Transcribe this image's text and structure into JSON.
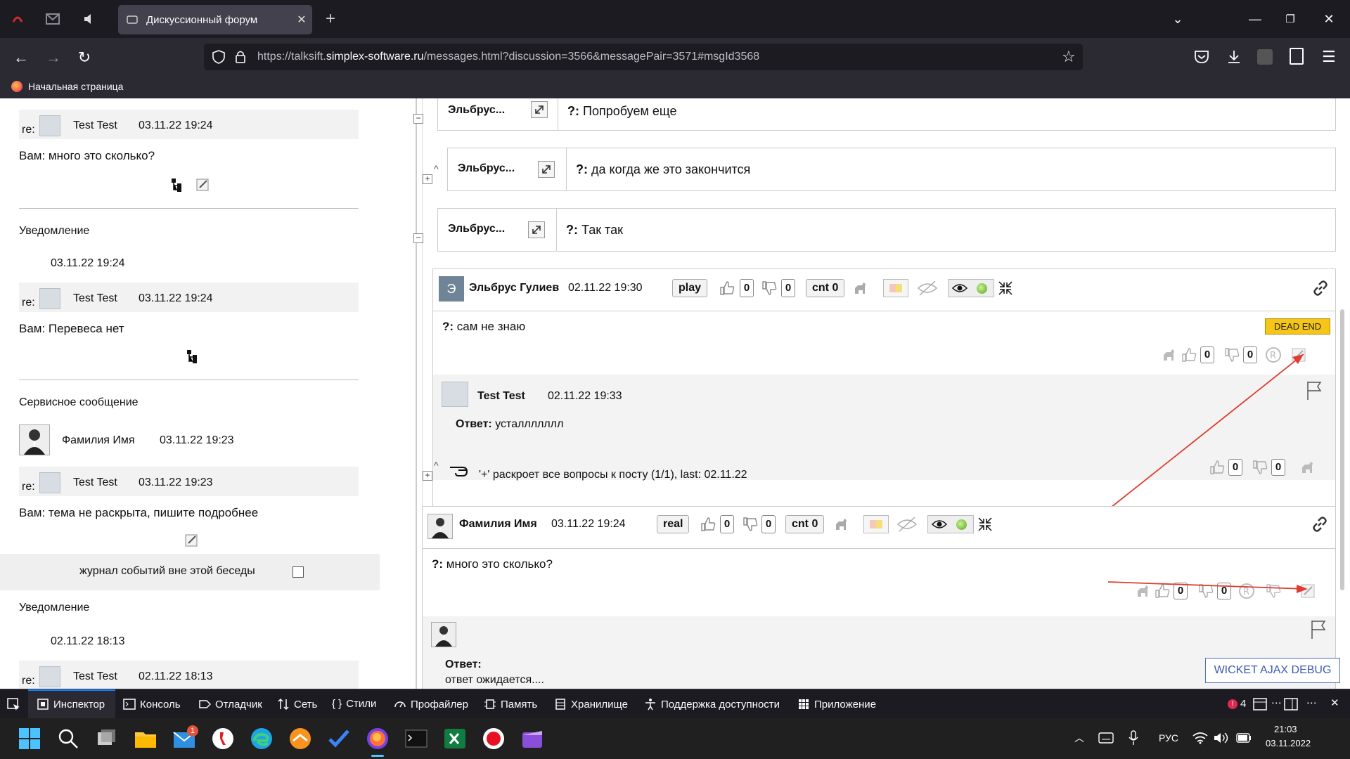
{
  "browser": {
    "tab_title": "Дискуссионный форум",
    "url_prefix": "https://talksift.",
    "url_domain": "simplex-software.ru",
    "url_rest": "/messages.html?discussion=3566&messagePair=3571#msgId3568",
    "bookmark": "Начальная страница"
  },
  "left": {
    "items": [
      {
        "re": "re:",
        "name": "Test Test",
        "date": "03.11.22 19:24",
        "text": "Вам: много это сколько?"
      },
      {
        "heading": "Уведомление",
        "date": "03.11.22 19:24"
      },
      {
        "re": "re:",
        "name": "Test Test",
        "date": "03.11.22 19:24",
        "text": "Вам: Перевеса нет"
      },
      {
        "heading": "Сервисное сообщение",
        "author": "Фамилия Имя",
        "date": "03.11.22 19:23"
      },
      {
        "re": "re:",
        "name": "Test Test",
        "date": "03.11.22 19:23",
        "text": "Вам: тема не раскрыта, пишите подробнее"
      },
      {
        "heading": "Уведомление",
        "date": "02.11.22 18:13"
      },
      {
        "re": "re:",
        "name": "Test Test",
        "date": "02.11.22 18:13"
      }
    ],
    "journal_label": "журнал событий вне этой беседы"
  },
  "right": {
    "collapsed": [
      {
        "name": "Эльбрус...",
        "prefix": "?:",
        "text": "Попробуем еще"
      },
      {
        "name": "Эльбрус...",
        "prefix": "?:",
        "text": "да когда же это закончится"
      },
      {
        "name": "Эльбрус...",
        "prefix": "?:",
        "text": "Так так"
      }
    ],
    "post1": {
      "avatar_letter": "Э",
      "author": "Эльбрус Гулиев",
      "date": "02.11.22 19:30",
      "mode": "play",
      "likes": "0",
      "dislikes": "0",
      "cnt": "cnt 0",
      "prefix": "?:",
      "question": "сам не знаю",
      "badge": "DEAD END",
      "q_likes": "0",
      "q_dislikes": "0",
      "answer_author": "Test Test",
      "answer_date": "02.11.22 19:33",
      "answer_label": "Ответ:",
      "answer_text": "усталлллллл",
      "a_likes": "0",
      "a_dislikes": "0",
      "hint": "'+' раскроет все вопросы к посту (1/1), last: 02.11.22"
    },
    "post2": {
      "author": "Фамилия Имя",
      "date": "03.11.22 19:24",
      "mode": "real",
      "likes": "0",
      "dislikes": "0",
      "cnt": "cnt 0",
      "prefix": "?:",
      "question": "много это сколько?",
      "q_likes": "0",
      "q_dislikes": "0",
      "answer_label": "Ответ:",
      "answer_text": "ответ ожидается...."
    },
    "wicket": "WICKET AJAX DEBUG"
  },
  "devtools": {
    "items": [
      "Инспектор",
      "Консоль",
      "Отладчик",
      "Сеть",
      "Стили",
      "Профайлер",
      "Память",
      "Хранилище",
      "Поддержка доступности",
      "Приложение"
    ],
    "errors": "4"
  },
  "taskbar": {
    "mail_badge": "1",
    "lang": "РУС",
    "time": "21:03",
    "date": "03.11.2022"
  },
  "colors": {
    "arrow": "#e03c31",
    "badge": "#f5c518",
    "accent": "#0a84ff"
  }
}
